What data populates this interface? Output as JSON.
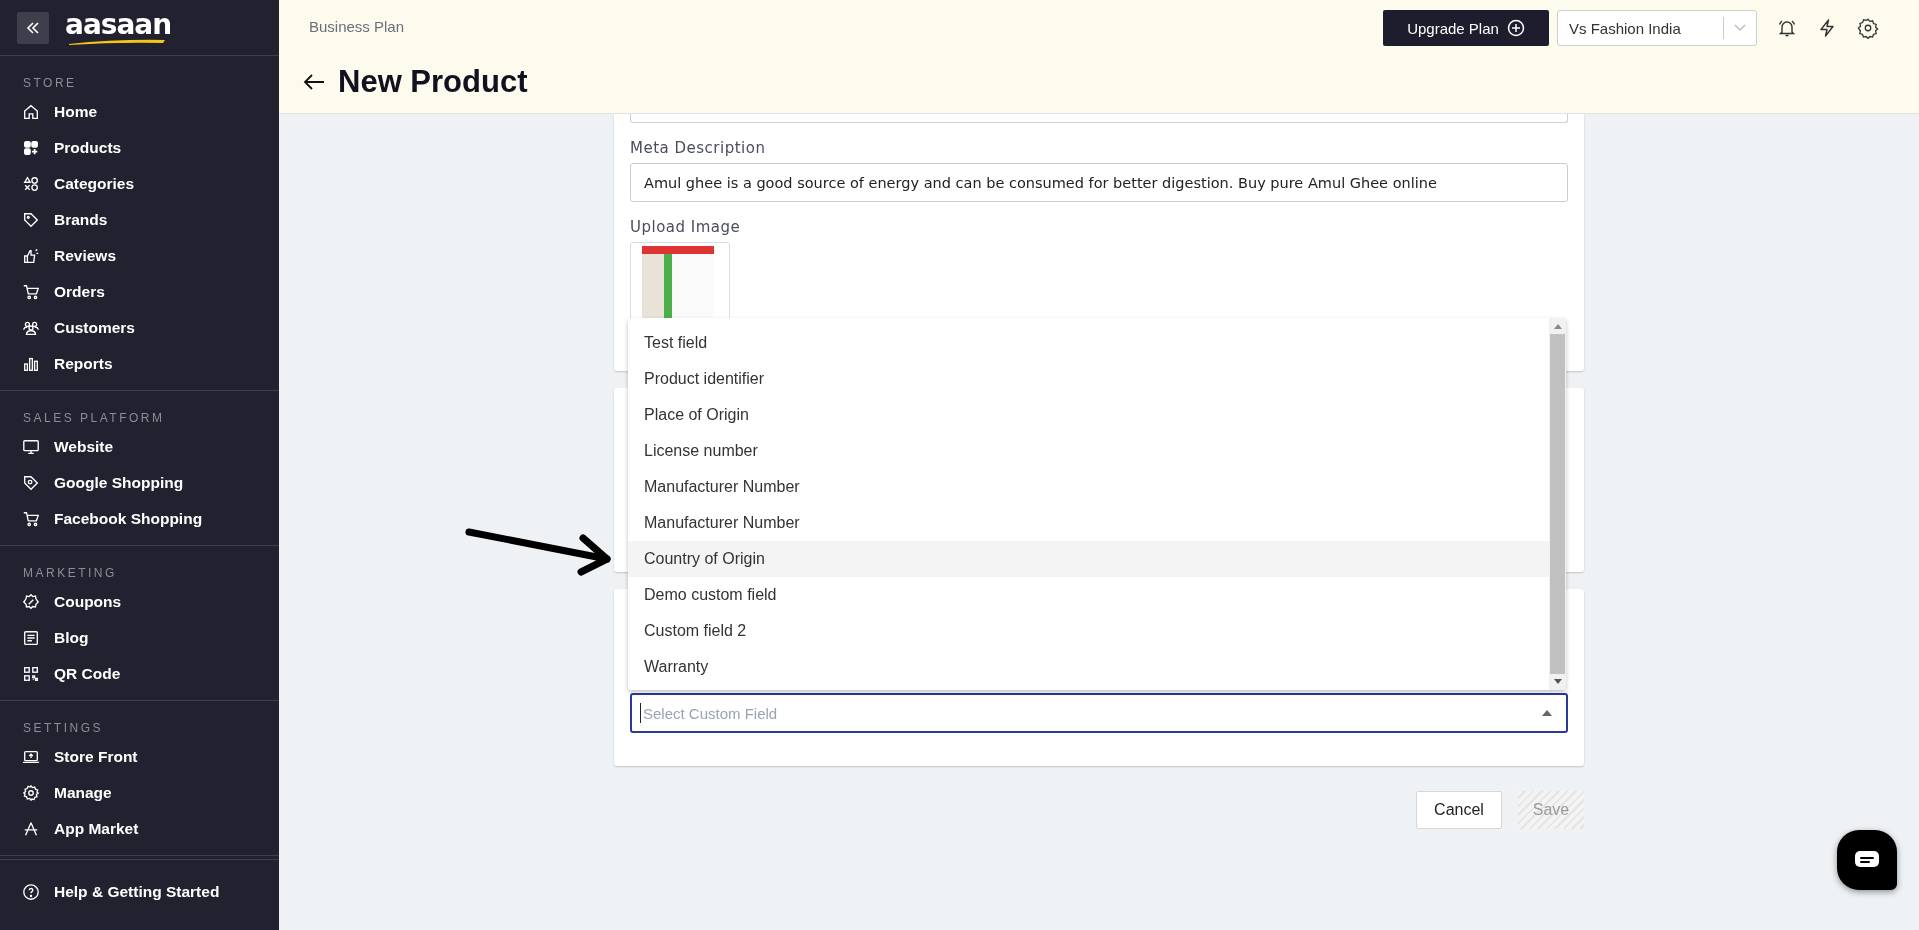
{
  "sidebar": {
    "logo": "aasaan",
    "sections": [
      {
        "title": "STORE",
        "items": [
          {
            "label": "Home"
          },
          {
            "label": "Products"
          },
          {
            "label": "Categories"
          },
          {
            "label": "Brands"
          },
          {
            "label": "Reviews"
          },
          {
            "label": "Orders"
          },
          {
            "label": "Customers"
          },
          {
            "label": "Reports"
          }
        ]
      },
      {
        "title": "SALES PLATFORM",
        "items": [
          {
            "label": "Website"
          },
          {
            "label": "Google Shopping"
          },
          {
            "label": "Facebook Shopping"
          }
        ]
      },
      {
        "title": "MARKETING",
        "items": [
          {
            "label": "Coupons"
          },
          {
            "label": "Blog"
          },
          {
            "label": "QR Code"
          }
        ]
      },
      {
        "title": "SETTINGS",
        "items": [
          {
            "label": "Store Front"
          },
          {
            "label": "Manage"
          },
          {
            "label": "App Market"
          }
        ]
      }
    ],
    "help": "Help & Getting Started"
  },
  "header": {
    "plan": "Business Plan",
    "upgrade_button": "Upgrade Plan",
    "store_select": {
      "value": "Vs Fashion India"
    },
    "title": "New Product"
  },
  "form": {
    "meta_description": {
      "label": "Meta Description",
      "value": "Amul ghee is a good source of energy and can be consumed for better digestion. Buy pure Amul Ghee online"
    },
    "upload_image": {
      "label": "Upload Image"
    }
  },
  "custom_field_select": {
    "placeholder": "Select Custom Field",
    "expanded": true,
    "options": [
      {
        "label": "Test field",
        "selected": false
      },
      {
        "label": "Product identifier",
        "selected": false
      },
      {
        "label": "Place of Origin",
        "selected": false
      },
      {
        "label": "License number",
        "selected": false
      },
      {
        "label": "Manufacturer Number",
        "selected": false
      },
      {
        "label": "Manufacturer Number",
        "selected": false
      },
      {
        "label": "Country of Origin",
        "selected": true
      },
      {
        "label": "Demo custom field",
        "selected": false
      },
      {
        "label": "Custom field 2",
        "selected": false
      },
      {
        "label": "Warranty",
        "selected": false
      }
    ]
  },
  "actions": {
    "cancel": "Cancel",
    "save": {
      "label": "Save",
      "disabled": true
    }
  }
}
